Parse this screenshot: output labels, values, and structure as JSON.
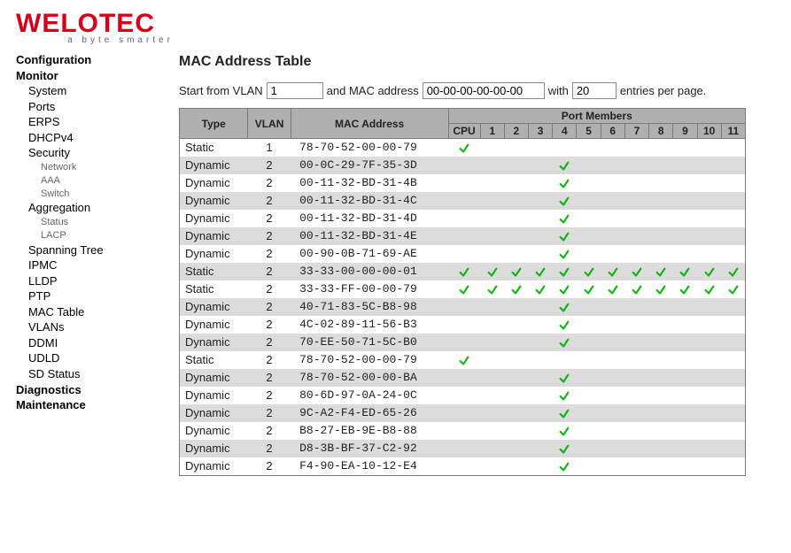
{
  "brand": {
    "name": "WELOTEC",
    "tagline": "a byte smarter"
  },
  "sidebar": {
    "items": [
      {
        "label": "Configuration",
        "bold": true,
        "indent": 0
      },
      {
        "label": "Monitor",
        "bold": true,
        "indent": 0
      },
      {
        "label": "System",
        "indent": 1
      },
      {
        "label": "Ports",
        "indent": 1
      },
      {
        "label": "ERPS",
        "indent": 1
      },
      {
        "label": "DHCPv4",
        "indent": 1
      },
      {
        "label": "Security",
        "indent": 1
      },
      {
        "label": "Network",
        "indent": 2
      },
      {
        "label": "AAA",
        "indent": 2
      },
      {
        "label": "Switch",
        "indent": 2
      },
      {
        "label": "Aggregation",
        "indent": 1
      },
      {
        "label": "Status",
        "indent": 2
      },
      {
        "label": "LACP",
        "indent": 2
      },
      {
        "label": "Spanning Tree",
        "indent": 1
      },
      {
        "label": "IPMC",
        "indent": 1
      },
      {
        "label": "LLDP",
        "indent": 1
      },
      {
        "label": "PTP",
        "indent": 1
      },
      {
        "label": "MAC Table",
        "indent": 1
      },
      {
        "label": "VLANs",
        "indent": 1
      },
      {
        "label": "DDMI",
        "indent": 1
      },
      {
        "label": "UDLD",
        "indent": 1
      },
      {
        "label": "SD Status",
        "indent": 1
      },
      {
        "label": "Diagnostics",
        "bold": true,
        "indent": 0
      },
      {
        "label": "Maintenance",
        "bold": true,
        "indent": 0
      }
    ]
  },
  "page": {
    "title": "MAC Address Table",
    "filter": {
      "label_start": "Start from VLAN",
      "vlan_value": "1",
      "label_mac": "and MAC address",
      "mac_value": "00-00-00-00-00-00",
      "label_with": "with",
      "count_value": "20",
      "label_end": "entries per page."
    },
    "columns": {
      "type": "Type",
      "vlan": "VLAN",
      "mac": "MAC Address",
      "port_members": "Port Members",
      "ports": [
        "CPU",
        "1",
        "2",
        "3",
        "4",
        "5",
        "6",
        "7",
        "8",
        "9",
        "10",
        "11"
      ]
    },
    "rows": [
      {
        "type": "Static",
        "vlan": "1",
        "mac": "78-70-52-00-00-79",
        "ports": [
          "CPU"
        ]
      },
      {
        "type": "Dynamic",
        "vlan": "2",
        "mac": "00-0C-29-7F-35-3D",
        "ports": [
          "4"
        ]
      },
      {
        "type": "Dynamic",
        "vlan": "2",
        "mac": "00-11-32-BD-31-4B",
        "ports": [
          "4"
        ]
      },
      {
        "type": "Dynamic",
        "vlan": "2",
        "mac": "00-11-32-BD-31-4C",
        "ports": [
          "4"
        ]
      },
      {
        "type": "Dynamic",
        "vlan": "2",
        "mac": "00-11-32-BD-31-4D",
        "ports": [
          "4"
        ]
      },
      {
        "type": "Dynamic",
        "vlan": "2",
        "mac": "00-11-32-BD-31-4E",
        "ports": [
          "4"
        ]
      },
      {
        "type": "Dynamic",
        "vlan": "2",
        "mac": "00-90-0B-71-69-AE",
        "ports": [
          "4"
        ]
      },
      {
        "type": "Static",
        "vlan": "2",
        "mac": "33-33-00-00-00-01",
        "ports": [
          "CPU",
          "1",
          "2",
          "3",
          "4",
          "5",
          "6",
          "7",
          "8",
          "9",
          "10",
          "11"
        ]
      },
      {
        "type": "Static",
        "vlan": "2",
        "mac": "33-33-FF-00-00-79",
        "ports": [
          "CPU",
          "1",
          "2",
          "3",
          "4",
          "5",
          "6",
          "7",
          "8",
          "9",
          "10",
          "11"
        ]
      },
      {
        "type": "Dynamic",
        "vlan": "2",
        "mac": "40-71-83-5C-B8-98",
        "ports": [
          "4"
        ]
      },
      {
        "type": "Dynamic",
        "vlan": "2",
        "mac": "4C-02-89-11-56-B3",
        "ports": [
          "4"
        ]
      },
      {
        "type": "Dynamic",
        "vlan": "2",
        "mac": "70-EE-50-71-5C-B0",
        "ports": [
          "4"
        ]
      },
      {
        "type": "Static",
        "vlan": "2",
        "mac": "78-70-52-00-00-79",
        "ports": [
          "CPU"
        ]
      },
      {
        "type": "Dynamic",
        "vlan": "2",
        "mac": "78-70-52-00-00-BA",
        "ports": [
          "4"
        ]
      },
      {
        "type": "Dynamic",
        "vlan": "2",
        "mac": "80-6D-97-0A-24-0C",
        "ports": [
          "4"
        ]
      },
      {
        "type": "Dynamic",
        "vlan": "2",
        "mac": "9C-A2-F4-ED-65-26",
        "ports": [
          "4"
        ]
      },
      {
        "type": "Dynamic",
        "vlan": "2",
        "mac": "B8-27-EB-9E-B8-88",
        "ports": [
          "4"
        ]
      },
      {
        "type": "Dynamic",
        "vlan": "2",
        "mac": "D8-3B-BF-37-C2-92",
        "ports": [
          "4"
        ]
      },
      {
        "type": "Dynamic",
        "vlan": "2",
        "mac": "F4-90-EA-10-12-E4",
        "ports": [
          "4"
        ]
      }
    ]
  }
}
